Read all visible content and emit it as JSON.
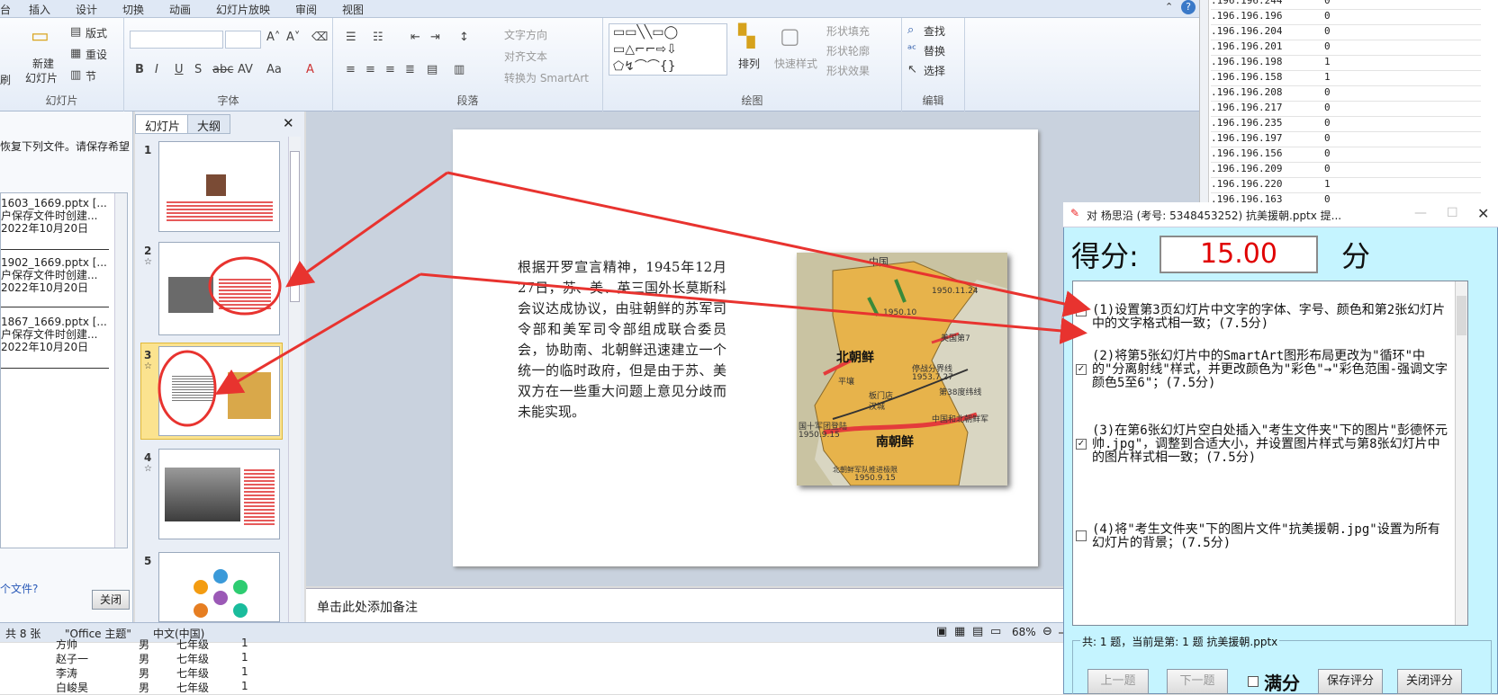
{
  "ribbon": {
    "tabs": [
      "台",
      "插入",
      "设计",
      "切换",
      "动画",
      "幻灯片放映",
      "审阅",
      "视图"
    ],
    "slides_group": {
      "label": "幻灯片",
      "new_slide": "新建",
      "new_slide2": "幻灯片",
      "layout": "版式",
      "reset": "重设",
      "section": "节",
      "brush": "刷"
    },
    "font_group": {
      "label": "字体"
    },
    "para_group": {
      "label": "段落",
      "text_direction": "文字方向",
      "align_text": "对齐文本",
      "smartart": "转换为 SmartArt"
    },
    "draw_group": {
      "label": "绘图",
      "arrange": "排列",
      "quick_styles": "快速样式",
      "shape_fill": "形状填充",
      "shape_outline": "形状轮廓",
      "shape_effects": "形状效果"
    },
    "edit_group": {
      "label": "编辑",
      "find": "查找",
      "replace": "替换",
      "select": "选择"
    }
  },
  "recover_pane": {
    "header": "恢复下列文件。请保存希望",
    "items": [
      {
        "name": "1603_1669.pptx   [...",
        "line2": "户保存文件时创建...",
        "date": "2022年10月20日"
      },
      {
        "name": "1902_1669.pptx   [...",
        "line2": "户保存文件时创建...",
        "date": "2022年10月20日"
      },
      {
        "name": "1867_1669.pptx   [...",
        "line2": "户保存文件时创建...",
        "date": "2022年10月20日"
      }
    ],
    "link": "个文件?",
    "close": "关闭"
  },
  "thumbs_pane": {
    "tab_slides": "幻灯片",
    "tab_outline": "大纲",
    "close": "✕",
    "numbers": [
      "1",
      "2",
      "3",
      "4",
      "5"
    ]
  },
  "slide": {
    "body": "根据开罗宣言精神，1945年12月27日，苏、美、英三国外长莫斯科会议达成协议，由驻朝鲜的苏军司令部和美军司令部组成联合委员会，协助南、北朝鲜迅速建立一个统一的临时政府，但是由于苏、美双方在一些重大问题上意见分歧而未能实现。",
    "map_labels": {
      "north": "北朝鲜",
      "south": "南朝鲜",
      "date1": "1950.11.24",
      "date2": "1950.10",
      "line38": "第38度纬线",
      "date3": "1953.7.27",
      "date4": "1950.9.15",
      "date5": "1950.9.15",
      "cease": "停战分界线",
      "pyongyang": "平壤",
      "seoul": "汉城",
      "panmunjom": "板门店",
      "us_troops": "美国第7",
      "cn": "中国",
      "land": "国十军团登陆",
      "china_korea": "中国和北朝鲜军",
      "nk_troops": "北朝鲜军队推进极限"
    }
  },
  "notes_placeholder": "单击此处添加备注",
  "status": {
    "slide_count": "共 8 张",
    "theme": "\"Office 主题\"",
    "lang": "中文(中国)",
    "zoom": "68%"
  },
  "excel_rows": [
    {
      "name": "方帅",
      "sex": "男",
      "grade": "七年级",
      "n": "1"
    },
    {
      "name": "赵子一",
      "sex": "男",
      "grade": "七年级",
      "n": "1"
    },
    {
      "name": "李涛",
      "sex": "男",
      "grade": "七年级",
      "n": "1"
    },
    {
      "name": "白峻昊",
      "sex": "男",
      "grade": "七年级",
      "n": "1"
    }
  ],
  "ip_rows": [
    {
      "ip": ".196.196.244",
      "v": "0"
    },
    {
      "ip": ".196.196.196",
      "v": "0"
    },
    {
      "ip": ".196.196.204",
      "v": "0"
    },
    {
      "ip": ".196.196.201",
      "v": "0"
    },
    {
      "ip": ".196.196.198",
      "v": "1"
    },
    {
      "ip": ".196.196.158",
      "v": "1"
    },
    {
      "ip": ".196.196.208",
      "v": "0"
    },
    {
      "ip": ".196.196.217",
      "v": "0"
    },
    {
      "ip": ".196.196.235",
      "v": "0"
    },
    {
      "ip": ".196.196.197",
      "v": "0"
    },
    {
      "ip": ".196.196.156",
      "v": "0"
    },
    {
      "ip": ".196.196.209",
      "v": "0"
    },
    {
      "ip": ".196.196.220",
      "v": "1"
    },
    {
      "ip": ".196.196.163",
      "v": "0"
    }
  ],
  "dialog": {
    "title": "对 杨思沿 (考号: 5348453252) 抗美援朝.pptx 提...",
    "score_label": "得分:",
    "score": "15.00",
    "unit": "分",
    "questions": [
      {
        "text": "(1)设置第3页幻灯片中文字的字体、字号、颜色和第2张幻灯片中的文字格式相一致；(7.5分)",
        "checked": false
      },
      {
        "text": "(2)将第5张幻灯片中的SmartArt图形布局更改为\"循环\"中的\"分离射线\"样式，并更改颜色为\"彩色\"→\"彩色范围-强调文字颜色5至6\"；(7.5分)",
        "checked": true
      },
      {
        "text": "(3)在第6张幻灯片空白处插入\"考生文件夹\"下的图片\"彭德怀元帅.jpg\"，调整到合适大小，并设置图片样式与第8张幻灯片中的图片样式相一致；(7.5分)",
        "checked": true
      },
      {
        "text": "(4)将\"考生文件夹\"下的图片文件\"抗美援朝.jpg\"设置为所有幻灯片的背景；(7.5分)",
        "checked": false
      }
    ],
    "footer": "共: 1 题，当前是第: 1 题 抗美援朝.pptx",
    "prev": "上一题",
    "next": "下一题",
    "full_mark": "满分",
    "save": "保存评分",
    "close": "关闭评分"
  },
  "colors": {
    "accent_red": "#e8332f",
    "score_red": "#e00000",
    "dialog_bg": "#c5f4ff"
  }
}
